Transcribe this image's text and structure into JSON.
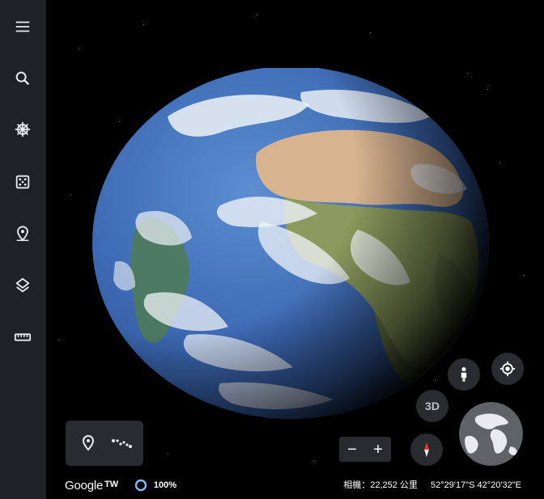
{
  "sidebar": {
    "items": [
      {
        "icon": "menu-icon"
      },
      {
        "icon": "search-icon"
      },
      {
        "icon": "voyager-wheel-icon"
      },
      {
        "icon": "dice-icon"
      },
      {
        "icon": "place-pin-icon"
      },
      {
        "icon": "layers-icon"
      },
      {
        "icon": "ruler-icon"
      }
    ]
  },
  "controls": {
    "three_d_label": "3D",
    "zoom_out_label": "−",
    "zoom_in_label": "+"
  },
  "footer": {
    "logo_text": "Google",
    "logo_suffix": "TW",
    "loading_percent": "100%",
    "camera_info": "相機：22,252 公里",
    "coordinates": "52°29'17\"S 42°20'32\"E"
  },
  "colors": {
    "sidebar_bg": "#202124",
    "panel_bg": "#2a2b2e",
    "ocean": "#3f6fb8",
    "compass_red": "#e53935",
    "progress_ring": "#8ab4f8"
  }
}
